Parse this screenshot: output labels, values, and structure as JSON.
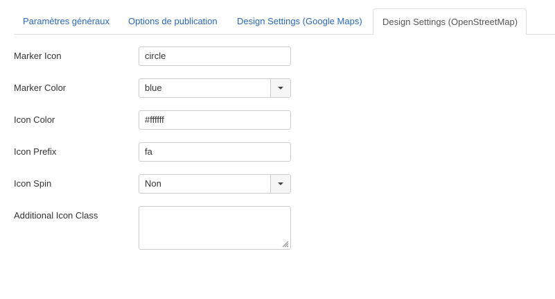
{
  "tabs": [
    {
      "label": "Paramètres généraux",
      "active": false
    },
    {
      "label": "Options de publication",
      "active": false
    },
    {
      "label": "Design Settings (Google Maps)",
      "active": false
    },
    {
      "label": "Design Settings (OpenStreetMap)",
      "active": true
    }
  ],
  "form": {
    "marker_icon": {
      "label": "Marker Icon",
      "value": "circle"
    },
    "marker_color": {
      "label": "Marker Color",
      "value": "blue"
    },
    "icon_color": {
      "label": "Icon Color",
      "value": "#ffffff"
    },
    "icon_prefix": {
      "label": "Icon Prefix",
      "value": "fa"
    },
    "icon_spin": {
      "label": "Icon Spin",
      "value": "Non"
    },
    "additional_icon_class": {
      "label": "Additional Icon Class",
      "value": ""
    }
  },
  "colors": {
    "link": "#2a69b8",
    "border": "#cccccc",
    "tab_border": "#dddddd"
  },
  "icons": {
    "dropdown": "chevron-down-icon",
    "resize": "resize-grip-icon"
  }
}
